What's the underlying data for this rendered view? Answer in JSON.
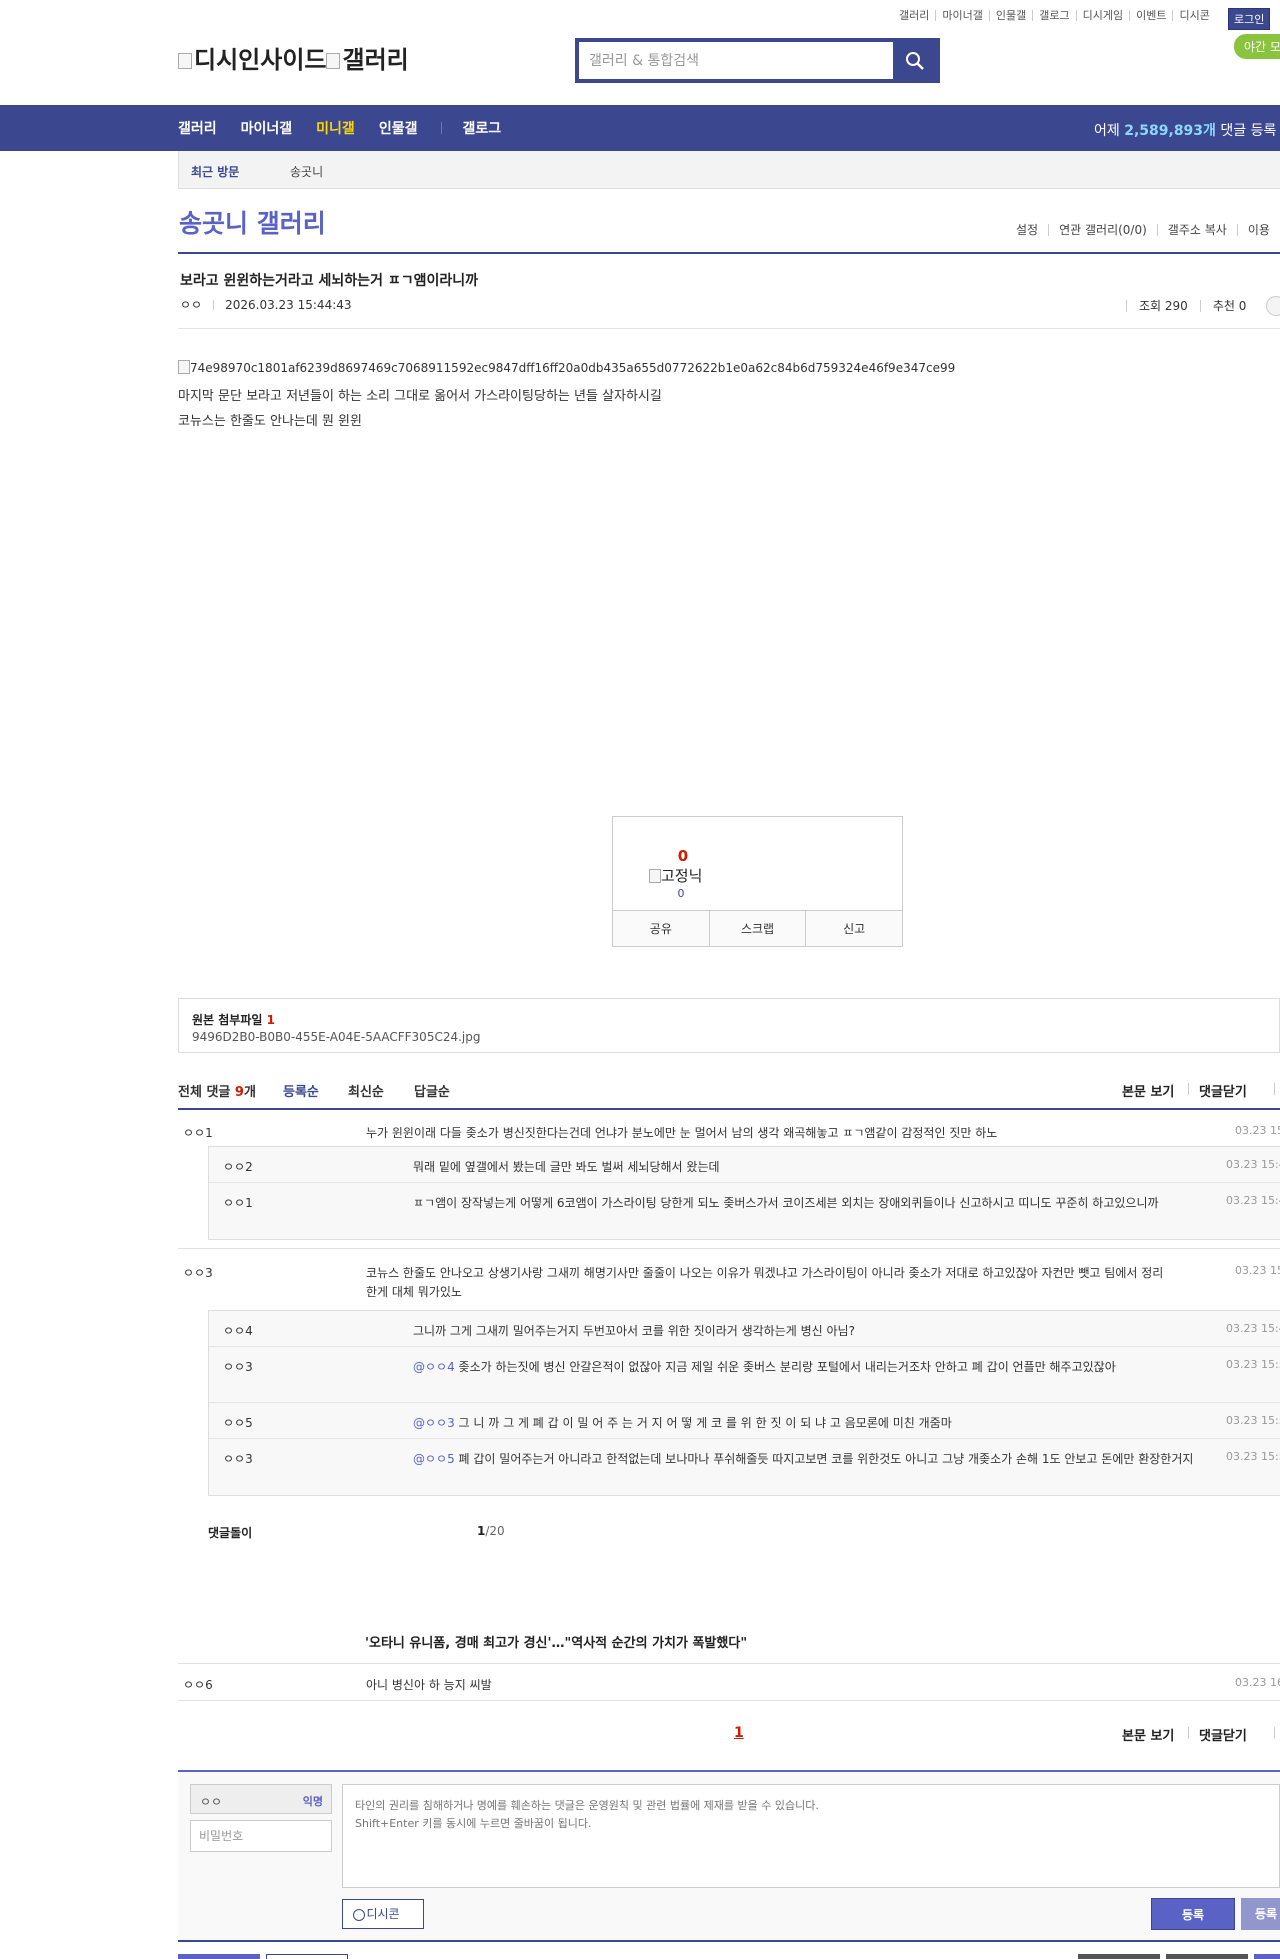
{
  "top_links": [
    "갤러리",
    "마이너갤",
    "인물갤",
    "갤로그",
    "디시게임",
    "이벤트",
    "디시콘"
  ],
  "login_label": "로그인",
  "night_label": "야간 모",
  "logo": {
    "site": "디시인사이드",
    "gallery": "갤러리"
  },
  "search": {
    "placeholder": "갤러리 & 통합검색"
  },
  "nav": {
    "items": [
      "갤러리",
      "마이너갤",
      "미니갤",
      "인물갤"
    ],
    "gallog": "갤로그",
    "stat_prefix": "어제 ",
    "stat_value": "2,589,893개",
    "stat_suffix": " 댓글 등록"
  },
  "visit": {
    "label": "최근 방문",
    "gallery": "송곳니"
  },
  "gallery_title": "송곳니 갤러리",
  "gallery_tools": [
    "설정",
    "연관 갤러리(0/0)",
    "갤주소 복사",
    "이용"
  ],
  "post": {
    "title": "보라고 윈윈하는거라고 세뇌하는거 ㅍㄱ앰이라니까",
    "author": "ㅇㅇ",
    "datetime": "2026.03.23 15:44:43",
    "views": "조회 290",
    "recommend": "추천 0",
    "image_alt": "74e98970c1801af6239d8697469c7068911592ec9847dff16ff20a0db435a655d0772622b1e0a62c84b6d759324e46f9e347ce99",
    "body": [
      "마지막 문단 보라고 저년들이 하는 소리 그대로 옮어서 가스라이팅당하는 년들 살자하시길",
      "코뉴스는 한줄도 안나는데 뭔 윈윈"
    ]
  },
  "recommend_box": {
    "count": "0",
    "fixed_alt": "고정닉",
    "fixed_count": "0",
    "share": "공유",
    "scrap": "스크랩",
    "report": "신고"
  },
  "attachment": {
    "label": "원본 첨부파일",
    "count": "1",
    "file": "9496D2B0-B0B0-455E-A04E-5AACFF305C24.jpg"
  },
  "comment_header": {
    "total_label": "전체 댓글",
    "total_count": "9",
    "total_unit": "개",
    "sort_registered": "등록순",
    "sort_latest": "최신순",
    "sort_reply": "답글순",
    "view_body": "본문 보기",
    "close_comments": "댓글닫기"
  },
  "comments": [
    {
      "nick": "ㅇㅇ1",
      "text": "누가 윈윈이래 다들 좆소가 병신짓한다는건데 언냐가 분노에만 눈 멀어서 남의 생각 왜곡해놓고 ㅍㄱ앰같이 감정적인 짓만 하노",
      "date": "03.23 15"
    },
    {
      "nick": "ㅇㅇ2",
      "text": "뭐래 밑에 옆갤에서 봤는데 글만 봐도 벌써 세뇌당해서 왔는데",
      "date": "03.23 15:4"
    },
    {
      "nick": "ㅇㅇ1",
      "text": "ㅍㄱ앰이 장작넣는게 어떻게 6코앰이 가스라이팅 당한게 되노 좆버스가서 코이즈세븐 외치는 장애외퀴들이나 신고하시고 띠니도 꾸준히 하고있으니까",
      "date": "03.23 15:4"
    },
    {
      "nick": "ㅇㅇ3",
      "text": "코뉴스 한줄도 안나오고 상생기사랑 그새끼 해명기사만 줄줄이 나오는 이유가 뭐겠냐고 가스라이팅이 아니라 좆소가 저대로 하고있잖아 자컨만 뺏고 팀에서 정리한게 대체 뭐가있노",
      "date": "03.23 15"
    },
    {
      "nick": "ㅇㅇ4",
      "text": "그니까 그게 그새끼 밀어주는거지 두번꼬아서 코를 위한 짓이라거 생각하는게 병신 아님?",
      "date": "03.23 15:4"
    },
    {
      "nick": "ㅇㅇ3",
      "mention": "@ㅇㅇ4",
      "text": " 좆소가 하는짓에 병신 안갈은적이 없잖아 지금 제일 쉬운 좆버스 분리랑 포털에서 내리는거조차 안하고 폐 갑이 언플만 해주고있잖아",
      "date": "03.23 15:5"
    },
    {
      "nick": "ㅇㅇ5",
      "mention": "@ㅇㅇ3",
      "text": " 그 니 까 그 게 폐 갑 이 밀 어 주 는 거 지 어 떻 게 코 를 위 한 짓 이 되 냐 고 음모론에 미친 개줌마",
      "date": "03.23 15:5"
    },
    {
      "nick": "ㅇㅇ3",
      "mention": "@ㅇㅇ5",
      "text": " 폐 갑이 밀어주는거 아니라고 한적없는데 보나마나 푸쉬해줄듯 따지고보면 코를 위한것도 아니고 그냥 개좆소가 손해 1도 안보고 돈에만 환장한거지",
      "date": "03.23 15:5"
    }
  ],
  "comment_pager": {
    "label": "댓글돌이",
    "current": "1",
    "total": "/20"
  },
  "news": "'오타니 유니폼, 경매 최고가 경신'…\"역사적 순간의 가치가 폭발했다\"",
  "last_comment": {
    "nick": "ㅇㅇ6",
    "text": "아니 병신아 하 능지 씨발",
    "date": "03.23 16"
  },
  "page": "1",
  "write": {
    "nick": "ㅇㅇ",
    "anon": "익명",
    "password_placeholder": "비밀번호",
    "memo_placeholder": "타인의 권리를 침해하거나 명예를 훼손하는 댓글은 운영원칙 및 관련 법률에 제재를 받을 수 있습니다.\nShift+Enter 키를 동시에 누르면 줄바꿈이 됩니다.",
    "dccon": "디시콘",
    "submit": "등록",
    "submit2": "등록"
  },
  "colors": {
    "brand": "#3b4890",
    "accent": "#5a63c5",
    "highlight": "#ffd600",
    "red": "#d31900",
    "night": "#8ac43f"
  }
}
